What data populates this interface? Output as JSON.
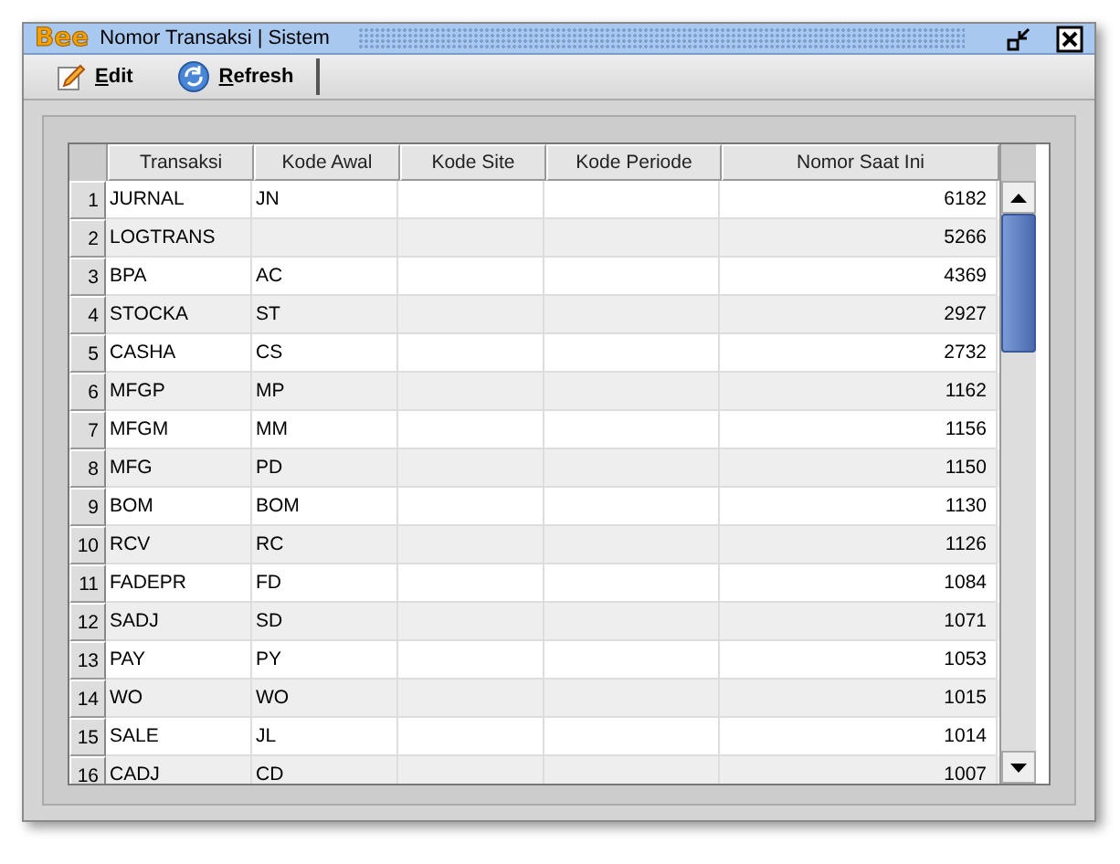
{
  "window": {
    "logo": "Bee",
    "title": "Nomor Transaksi | Sistem"
  },
  "toolbar": [
    {
      "kind": "edit",
      "label": "Edit"
    },
    {
      "kind": "refresh",
      "label": "Refresh"
    }
  ],
  "table": {
    "columns": [
      "Transaksi",
      "Kode Awal",
      "Kode Site",
      "Kode Periode",
      "Nomor Saat Ini"
    ],
    "rows": [
      {
        "no": "1",
        "cells": [
          "JURNAL",
          "JN",
          "",
          "",
          "6182"
        ]
      },
      {
        "no": "2",
        "cells": [
          "LOGTRANS",
          "",
          "",
          "",
          "5266"
        ]
      },
      {
        "no": "3",
        "cells": [
          "BPA",
          "AC",
          "",
          "",
          "4369"
        ]
      },
      {
        "no": "4",
        "cells": [
          "STOCKA",
          "ST",
          "",
          "",
          "2927"
        ]
      },
      {
        "no": "5",
        "cells": [
          "CASHA",
          "CS",
          "",
          "",
          "2732"
        ]
      },
      {
        "no": "6",
        "cells": [
          "MFGP",
          "MP",
          "",
          "",
          "1162"
        ]
      },
      {
        "no": "7",
        "cells": [
          "MFGM",
          "MM",
          "",
          "",
          "1156"
        ]
      },
      {
        "no": "8",
        "cells": [
          "MFG",
          "PD",
          "",
          "",
          "1150"
        ]
      },
      {
        "no": "9",
        "cells": [
          "BOM",
          "BOM",
          "",
          "",
          "1130"
        ]
      },
      {
        "no": "10",
        "cells": [
          "RCV",
          "RC",
          "",
          "",
          "1126"
        ]
      },
      {
        "no": "11",
        "cells": [
          "FADEPR",
          "FD",
          "",
          "",
          "1084"
        ]
      },
      {
        "no": "12",
        "cells": [
          "SADJ",
          "SD",
          "",
          "",
          "1071"
        ]
      },
      {
        "no": "13",
        "cells": [
          "PAY",
          "PY",
          "",
          "",
          "1053"
        ]
      },
      {
        "no": "14",
        "cells": [
          "WO",
          "WO",
          "",
          "",
          "1015"
        ]
      },
      {
        "no": "15",
        "cells": [
          "SALE",
          "JL",
          "",
          "",
          "1014"
        ]
      },
      {
        "no": "16",
        "cells": [
          "CADJ",
          "CD",
          "",
          "",
          "1007"
        ]
      }
    ]
  }
}
